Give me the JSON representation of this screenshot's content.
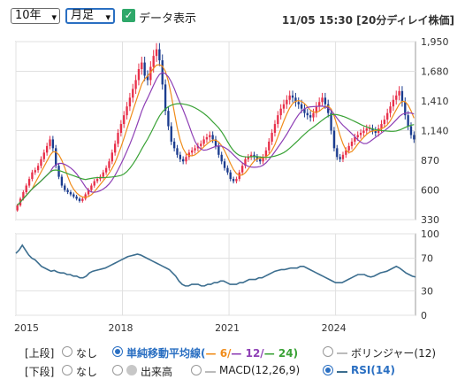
{
  "toolbar": {
    "period": "10年",
    "interval": "月足",
    "data_display_label": "データ表示",
    "timestamp": "11/05 15:30 [20分ディレイ株価]"
  },
  "legend": {
    "upper_label": "[上段]",
    "lower_label": "[下段]",
    "none": "なし",
    "sma_label": "単純移動平均線(",
    "sma_6": "6/",
    "sma_12": "12/",
    "sma_24": "24)",
    "bollinger": "ボリンジャー(12)",
    "volume": "出来高",
    "macd": "MACD(12,26,9)",
    "rsi": "RSI(14)",
    "colors": {
      "up": "#e8304a",
      "down": "#1b3c8f",
      "sma6": "#f08c1a",
      "sma12": "#8e3fb5",
      "sma24": "#3aa236",
      "rsi": "#3c6e8f"
    }
  },
  "chart_data": [
    {
      "type": "candlestick",
      "title": "",
      "x_ticks": [
        "2015",
        "2018",
        "2021",
        "2024"
      ],
      "y_ticks": [
        330,
        600,
        870,
        1140,
        1410,
        1680,
        1950
      ],
      "ylim": [
        330,
        1950
      ],
      "start": "2015-01",
      "grid": true,
      "close": [
        460,
        520,
        580,
        640,
        700,
        760,
        780,
        820,
        880,
        940,
        1000,
        1060,
        980,
        820,
        720,
        640,
        600,
        580,
        560,
        540,
        520,
        500,
        520,
        560,
        600,
        640,
        680,
        700,
        720,
        760,
        800,
        860,
        940,
        1020,
        1120,
        1200,
        1280,
        1360,
        1440,
        1520,
        1600,
        1700,
        1760,
        1640,
        1600,
        1720,
        1820,
        1880,
        1780,
        1560,
        1320,
        1180,
        1040,
        980,
        920,
        880,
        860,
        900,
        940,
        960,
        980,
        1000,
        1020,
        1060,
        1080,
        1100,
        1060,
        1000,
        920,
        860,
        800,
        760,
        700,
        680,
        700,
        760,
        820,
        880,
        900,
        920,
        900,
        880,
        860,
        900,
        960,
        1040,
        1120,
        1200,
        1280,
        1340,
        1380,
        1420,
        1460,
        1440,
        1400,
        1380,
        1340,
        1300,
        1280,
        1260,
        1300,
        1360,
        1400,
        1440,
        1380,
        1300,
        1140,
        980,
        900,
        880,
        920,
        960,
        1000,
        1040,
        1080,
        1100,
        1120,
        1140,
        1160,
        1160,
        1140,
        1120,
        1160,
        1200,
        1240,
        1300,
        1360,
        1420,
        1460,
        1500,
        1400,
        1280,
        1180,
        1100,
        1060
      ]
    },
    {
      "type": "line",
      "series_name": "RSI(14)",
      "y_ticks": [
        0,
        30,
        70,
        100
      ],
      "ylim": [
        0,
        100
      ],
      "values": [
        76,
        80,
        86,
        80,
        74,
        70,
        68,
        64,
        60,
        58,
        56,
        54,
        55,
        53,
        52,
        52,
        50,
        50,
        48,
        48,
        46,
        46,
        48,
        52,
        54,
        55,
        56,
        57,
        58,
        60,
        62,
        64,
        66,
        68,
        70,
        72,
        73,
        74,
        75,
        74,
        72,
        70,
        68,
        66,
        64,
        62,
        60,
        58,
        56,
        52,
        48,
        42,
        38,
        36,
        36,
        38,
        38,
        38,
        36,
        36,
        38,
        38,
        40,
        40,
        42,
        42,
        40,
        38,
        38,
        38,
        40,
        40,
        42,
        44,
        44,
        44,
        46,
        46,
        48,
        50,
        52,
        54,
        55,
        56,
        56,
        57,
        58,
        58,
        58,
        60,
        60,
        58,
        56,
        54,
        52,
        50,
        48,
        46,
        44,
        42,
        40,
        40,
        40,
        42,
        44,
        46,
        48,
        50,
        50,
        50,
        48,
        47,
        48,
        50,
        52,
        53,
        54,
        56,
        58,
        60,
        58,
        55,
        52,
        50,
        48,
        47
      ]
    }
  ]
}
